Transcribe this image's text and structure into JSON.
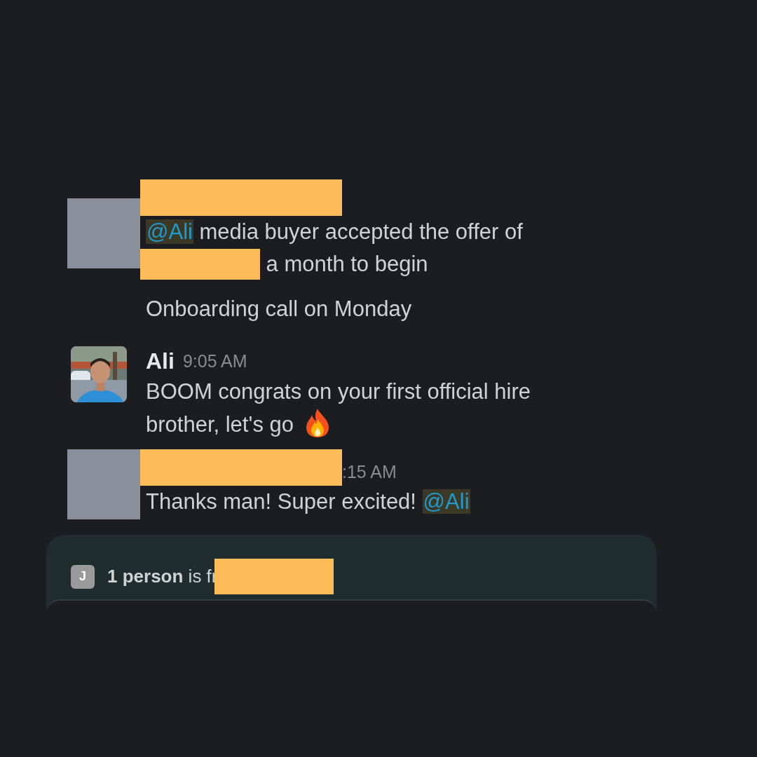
{
  "messages": [
    {
      "avatar": {
        "kind": "placeholder"
      },
      "header": [
        {
          "kind": "redaction"
        }
      ],
      "paragraphs": [
        [
          {
            "kind": "mention",
            "text": "@Ali"
          },
          {
            "kind": "text",
            "text": " media buyer accepted the offer of "
          },
          {
            "kind": "redaction"
          },
          {
            "kind": "text",
            "text": " a month to begin"
          }
        ],
        [
          {
            "kind": "text",
            "text": "Onboarding call on Monday"
          }
        ]
      ]
    },
    {
      "avatar": {
        "kind": "picture"
      },
      "header": [
        {
          "kind": "author",
          "text": "Ali"
        },
        {
          "kind": "time",
          "text": "9:05 AM"
        }
      ],
      "paragraphs": [
        [
          {
            "kind": "text",
            "text": "BOOM congrats on your first official hire brother, let's go"
          },
          {
            "kind": "emoji"
          }
        ]
      ]
    },
    {
      "avatar": {
        "kind": "placeholder"
      },
      "header": [
        {
          "kind": "redaction"
        },
        {
          "kind": "time",
          "text": ":15 AM"
        }
      ],
      "paragraphs": [
        [
          {
            "kind": "text",
            "text": "Thanks man! Super excited! "
          },
          {
            "kind": "mention",
            "text": "@Ali"
          }
        ]
      ]
    }
  ],
  "typing": {
    "badge": "J",
    "count": "1 person",
    "text": " is fr"
  }
}
